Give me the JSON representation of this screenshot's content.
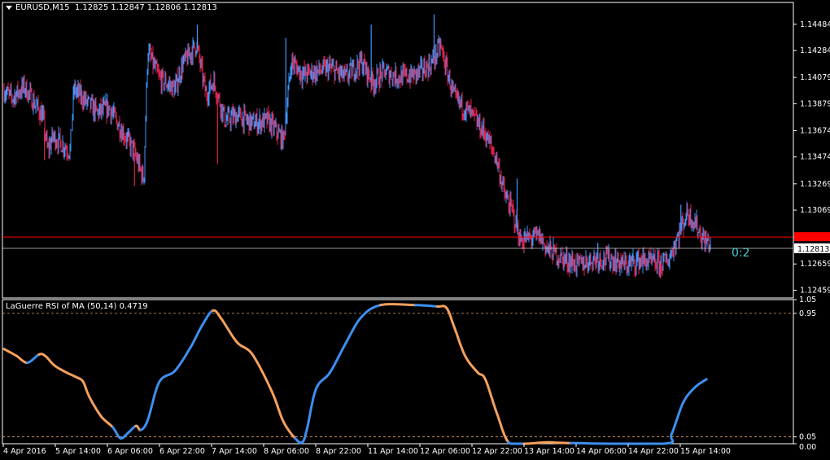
{
  "main_header": {
    "symbol": "EURUSD,M15",
    "ohlc": "1.12825 1.12847 1.12806 1.12813"
  },
  "indicator_header": {
    "label": "LaGuerre RSI of MA (50,14) 0.4719"
  },
  "annotation": "0:2",
  "colors": {
    "bull": "#3d97ff",
    "bear": "#e0214a",
    "rsi_up": "#3d8ff0",
    "rsi_down": "#f5a05c",
    "grid_frame": "#ffffff",
    "horizontal_line": "#ff0000",
    "level_dash": "#e8a060",
    "annotation": "#40d0d0"
  },
  "chart_data": [
    {
      "type": "candlestick",
      "symbol": "EURUSD",
      "timeframe": "M15",
      "ylim": [
        1.124,
        1.1465
      ],
      "yticks": [
        "1.14484",
        "1.14284",
        "1.14079",
        "1.13879",
        "1.13674",
        "1.13474",
        "1.13269",
        "1.13069",
        "1.12864",
        "1.12659",
        "1.12459"
      ],
      "last_price": "1.12813",
      "red_line_price": 1.12864,
      "grid": false,
      "path": [
        [
          0,
          1.1398
        ],
        [
          1.0,
          1.1392
        ],
        [
          2.6,
          1.1401
        ],
        [
          5.0,
          1.1378
        ],
        [
          5.6,
          1.1352
        ],
        [
          6.3,
          1.1363
        ],
        [
          8.5,
          1.1352
        ],
        [
          9.0,
          1.1399
        ],
        [
          12.0,
          1.1381
        ],
        [
          13.5,
          1.1385
        ],
        [
          16.7,
          1.1352
        ],
        [
          18.0,
          1.133
        ],
        [
          18.5,
          1.1428
        ],
        [
          20.0,
          1.1407
        ],
        [
          22.0,
          1.1399
        ],
        [
          23.0,
          1.1418
        ],
        [
          24.8,
          1.1433
        ],
        [
          26.0,
          1.1395
        ],
        [
          27.0,
          1.1405
        ],
        [
          28.5,
          1.1375
        ],
        [
          30.0,
          1.1379
        ],
        [
          32.0,
          1.1373
        ],
        [
          34.0,
          1.1375
        ],
        [
          36.0,
          1.136
        ],
        [
          37.0,
          1.142
        ],
        [
          38.5,
          1.141
        ],
        [
          40.0,
          1.1412
        ],
        [
          42.0,
          1.1415
        ],
        [
          44.0,
          1.1408
        ],
        [
          46.0,
          1.142
        ],
        [
          47.5,
          1.1404
        ],
        [
          49.0,
          1.1412
        ],
        [
          51.0,
          1.1408
        ],
        [
          53.0,
          1.141
        ],
        [
          55.0,
          1.1418
        ],
        [
          56.2,
          1.1432
        ],
        [
          58.0,
          1.1392
        ],
        [
          60.0,
          1.1381
        ],
        [
          62.0,
          1.1365
        ],
        [
          63.5,
          1.1345
        ],
        [
          64.5,
          1.1318
        ],
        [
          65.5,
          1.1306
        ],
        [
          66.5,
          1.1284
        ],
        [
          69.0,
          1.1287
        ],
        [
          70.0,
          1.1277
        ],
        [
          72.0,
          1.127
        ],
        [
          74.0,
          1.1265
        ],
        [
          76.0,
          1.127
        ],
        [
          78.0,
          1.127
        ],
        [
          80.0,
          1.1265
        ],
        [
          82.0,
          1.1269
        ],
        [
          84.0,
          1.1266
        ],
        [
          85.5,
          1.1268
        ],
        [
          87.0,
          1.129
        ],
        [
          88.0,
          1.1305
        ],
        [
          89.0,
          1.1298
        ],
        [
          90.0,
          1.1285
        ],
        [
          91.0,
          1.1281
        ]
      ],
      "spikes": [
        [
          18.7,
          1.1431
        ],
        [
          24.9,
          1.1448
        ],
        [
          36.3,
          1.1438
        ],
        [
          47.3,
          1.1448
        ],
        [
          55.4,
          1.1456
        ],
        [
          66.1,
          1.1331
        ],
        [
          76.5,
          1.1282
        ],
        [
          84.6,
          1.1255
        ],
        [
          87.2,
          1.1311
        ],
        [
          5.2,
          1.1345
        ],
        [
          16.8,
          1.1325
        ],
        [
          27.5,
          1.1342
        ],
        [
          67.0,
          1.1275
        ]
      ],
      "x_count": 91
    },
    {
      "type": "line",
      "title": "LaGuerre RSI of MA (50,14) 0.4719",
      "ylim": [
        0,
        1.05
      ],
      "yticks": [
        "1.05",
        "0.95",
        "0.05",
        "0.00"
      ],
      "levels": [
        0.95,
        0.05
      ],
      "xlabels": [
        "4 Apr 2016",
        "5 Apr 14:00",
        "6 Apr 06:00",
        "6 Apr 22:00",
        "7 Apr 14:00",
        "8 Apr 06:00",
        "8 Apr 22:00",
        "11 Apr 14:00",
        "12 Apr 06:00",
        "12 Apr 22:00",
        "13 Apr 14:00",
        "14 Apr 06:00",
        "14 Apr 22:00",
        "15 Apr 14:00"
      ],
      "series": [
        {
          "points": [
            [
              0,
              0.69
            ],
            [
              1.6,
              0.64
            ],
            [
              3.0,
              0.59
            ],
            [
              4.5,
              0.65
            ],
            [
              5.3,
              0.64
            ],
            [
              6.5,
              0.57
            ],
            [
              8.0,
              0.52
            ],
            [
              9.5,
              0.48
            ],
            [
              10.2,
              0.45
            ],
            [
              11.0,
              0.34
            ],
            [
              12.5,
              0.2
            ],
            [
              14.0,
              0.12
            ],
            [
              15.0,
              0.04
            ],
            [
              16.0,
              0.08
            ],
            [
              17.0,
              0.13
            ],
            [
              17.6,
              0.1
            ],
            [
              18.5,
              0.17
            ],
            [
              20.0,
              0.45
            ],
            [
              22.0,
              0.53
            ],
            [
              24.0,
              0.7
            ],
            [
              25.5,
              0.86
            ],
            [
              26.9,
              0.97
            ],
            [
              28.0,
              0.91
            ],
            [
              30.0,
              0.74
            ],
            [
              32.0,
              0.65
            ],
            [
              34.5,
              0.38
            ],
            [
              36.0,
              0.16
            ],
            [
              37.5,
              0.04
            ],
            [
              38.4,
              0.01
            ],
            [
              39.0,
              0.1
            ],
            [
              40.2,
              0.4
            ],
            [
              42.0,
              0.52
            ],
            [
              44.0,
              0.73
            ],
            [
              46.0,
              0.92
            ],
            [
              48.5,
              1.01
            ],
            [
              53.0,
              1.01
            ],
            [
              55.8,
              1.0
            ],
            [
              57.0,
              0.99
            ],
            [
              58.0,
              0.85
            ],
            [
              59.4,
              0.64
            ],
            [
              61.0,
              0.52
            ],
            [
              62.0,
              0.47
            ],
            [
              63.5,
              0.22
            ],
            [
              65.0,
              0.01
            ],
            [
              67.0,
              0.0
            ],
            [
              70.0,
              0.01
            ],
            [
              73.0,
              0.005
            ],
            [
              85.0,
              0.0
            ],
            [
              86.0,
              0.07
            ],
            [
              87.5,
              0.3
            ],
            [
              89.0,
              0.41
            ],
            [
              90.5,
              0.47
            ]
          ],
          "direction": [
            "d",
            "d",
            "u",
            "d",
            "d",
            "d",
            "d",
            "d",
            "d",
            "d",
            "d",
            "u",
            "u",
            "u",
            "d",
            "u",
            "u",
            "u",
            "u",
            "u",
            "u",
            "d",
            "d",
            "d",
            "d",
            "d",
            "d",
            "u",
            "u",
            "u",
            "u",
            "u",
            "u",
            "u",
            "d",
            "u",
            "d",
            "d",
            "d",
            "d",
            "d",
            "d",
            "d",
            "u",
            "d",
            "d",
            "u",
            "u",
            "u",
            "u",
            "u"
          ]
        }
      ]
    }
  ]
}
